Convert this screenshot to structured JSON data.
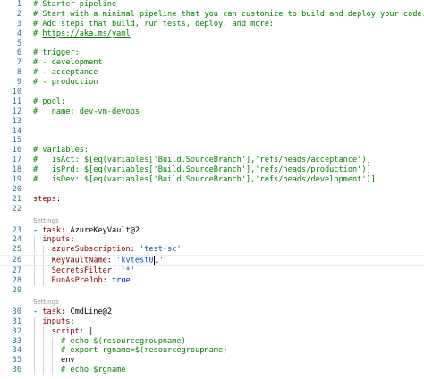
{
  "editor": {
    "lines": [
      {
        "n": "1",
        "text": "# Starter pipeline"
      },
      {
        "n": "2",
        "text": "# Start with a minimal pipeline that you can customize to build and deploy your code."
      },
      {
        "n": "3",
        "text": "# Add steps that build, run tests, deploy, and more:"
      },
      {
        "n": "4",
        "text": "# https://aka.ms/yaml"
      },
      {
        "n": "5",
        "text": ""
      },
      {
        "n": "6",
        "text": "# trigger:"
      },
      {
        "n": "7",
        "text": "# - development"
      },
      {
        "n": "8",
        "text": "# - acceptance"
      },
      {
        "n": "9",
        "text": "# - production"
      },
      {
        "n": "10",
        "text": ""
      },
      {
        "n": "11",
        "text": "# pool:"
      },
      {
        "n": "12",
        "text": "#   name: dev-vm-devops"
      },
      {
        "n": "13",
        "text": ""
      },
      {
        "n": "14",
        "text": ""
      },
      {
        "n": "15",
        "text": ""
      },
      {
        "n": "16",
        "text": "# variables:"
      },
      {
        "n": "17",
        "text": "#   isAct: $[eq(variables['Build.SourceBranch'],'refs/heads/acceptance')]"
      },
      {
        "n": "18",
        "text": "#   isPrd: $[eq(variables['Build.SourceBranch'],'refs/heads/production')]"
      },
      {
        "n": "19",
        "text": "#   isDev: $[eq(variables['Build.SourceBranch'],'refs/heads/development')]"
      },
      {
        "n": "20",
        "text": ""
      },
      {
        "n": "21",
        "text": "steps:"
      },
      {
        "n": "22",
        "text": ""
      },
      {
        "n": "23",
        "text": "- task: AzureKeyVault@2"
      },
      {
        "n": "24",
        "text": "  inputs:"
      },
      {
        "n": "25",
        "text": "    azureSubscription: 'test-sc'"
      },
      {
        "n": "26",
        "text": "    KeyVaultName: 'kvtest01'"
      },
      {
        "n": "27",
        "text": "    SecretsFilter: '*'"
      },
      {
        "n": "28",
        "text": "    RunAsPreJob: true"
      },
      {
        "n": "29",
        "text": ""
      },
      {
        "n": "30",
        "text": "- task: CmdLine@2"
      },
      {
        "n": "31",
        "text": "  inputs:"
      },
      {
        "n": "32",
        "text": "    script: |"
      },
      {
        "n": "33",
        "text": "      # echo $(resourcegroupname)"
      },
      {
        "n": "34",
        "text": "      # export rgname=$(resourcegroupname)"
      },
      {
        "n": "35",
        "text": "      env"
      },
      {
        "n": "36",
        "text": "      # echo $rgname"
      }
    ],
    "codelens": {
      "before_23": "Settings",
      "before_30": "Settings"
    }
  },
  "colors": {
    "comment": "#008000",
    "key": "#800000",
    "string": "#0451a5",
    "keyword": "#0000ff",
    "line_number": "#237893",
    "codelens": "#919191"
  }
}
